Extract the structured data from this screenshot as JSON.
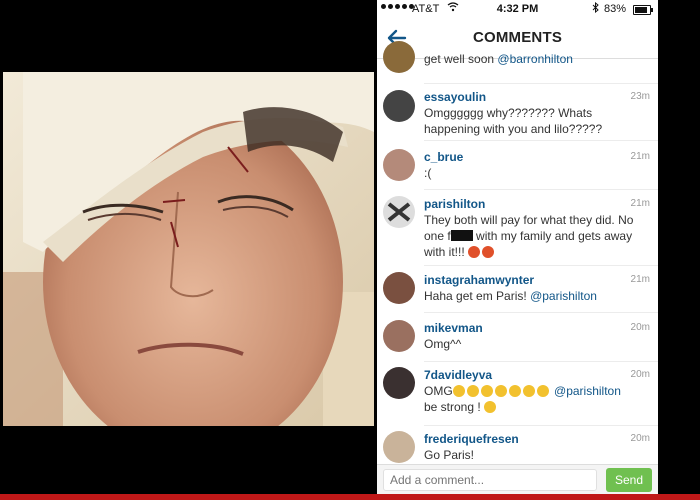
{
  "status_bar": {
    "carrier": "AT&T",
    "time": "4:32 PM",
    "battery_pct": "83%",
    "battery_level": 0.83
  },
  "header": {
    "title": "COMMENTS"
  },
  "comments": [
    {
      "username": "",
      "time": "",
      "text_parts": [
        "get well soon ",
        "@barronhilton"
      ]
    },
    {
      "username": "essayoulin",
      "time": "23m",
      "text": "Omgggggg why??????? Whats happening with you and lilo?????"
    },
    {
      "username": "c_brue",
      "time": "21m",
      "text": ":("
    },
    {
      "username": "parishilton",
      "time": "21m",
      "text_a": "They both will pay for what they did. No one f",
      "text_b": " with my family and gets away with it!!! "
    },
    {
      "username": "instagrahamwynter",
      "time": "21m",
      "text_a": "Haha get em Paris! ",
      "mention": "@parishilton"
    },
    {
      "username": "mikevman",
      "time": "20m",
      "text": "Omg^^"
    },
    {
      "username": "7davidleyva",
      "time": "20m",
      "text_a": "OMG",
      "mention": "@parishilton",
      "text_b": "be strong ! "
    },
    {
      "username": "frederiquefresen",
      "time": "20m",
      "text": "Go Paris!"
    }
  ],
  "input": {
    "placeholder": "Add a comment...",
    "send_label": "Send"
  },
  "colors": {
    "username": "#125688",
    "send": "#70c050",
    "bottom_strip": "#c01818"
  }
}
